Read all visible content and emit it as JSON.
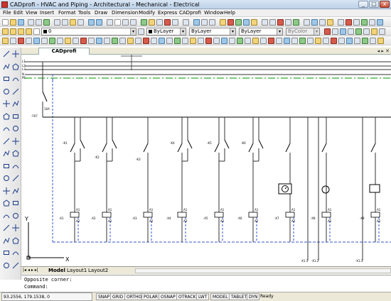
{
  "window": {
    "title": "CADprofi - HVAC and Piping - Architectural - Mechanical - Electrical",
    "minimize": "_",
    "maximize": "□",
    "close": "x"
  },
  "menu": {
    "items": [
      "File",
      "Edit",
      "View",
      "Insert",
      "Format",
      "Tools",
      "Draw",
      "Dimension",
      "Modify",
      "Express",
      "CADprofi",
      "Window",
      "Help"
    ]
  },
  "properties_toolbar": {
    "layer_value": "0",
    "color_value": "ByLayer",
    "linetype_value": "ByLayer",
    "lineweight_value": "ByLayer",
    "plotstyle_value": "ByColor"
  },
  "document": {
    "tab_label": "CADprofi",
    "nav": "◂ ▸ ✕"
  },
  "drawing": {
    "bus_labels": [
      "L1",
      "L2",
      "L3",
      "N",
      "PE"
    ],
    "main_switch_label": "-F07",
    "main_switch_rating": "16A",
    "branch_switch_labels": [
      "-K1",
      "-K2",
      "-K3",
      "-K4",
      "-K5",
      "-K6"
    ],
    "device_labels": [
      "-X1",
      "-X2",
      "-X3",
      "-X4",
      "-X5",
      "-X6",
      "-X7",
      "-X8",
      "-X9"
    ],
    "bottom_terminal_labels": [
      "-X1.1",
      "-X1.2",
      "-X1.3"
    ],
    "terminal_pin_labels": [
      "A1",
      "A2"
    ]
  },
  "ucs": {
    "x_label": "X",
    "y_label": "Y"
  },
  "layout_tabs": {
    "model": "Model",
    "layout1": "Layout1",
    "layout2": "Layout2"
  },
  "command": {
    "line1": "Opposite corner:",
    "line2": "Command:"
  },
  "status": {
    "coords": "93.2556, 179.1538, 0",
    "buttons": [
      "SNAP",
      "GRID",
      "ORTHO",
      "POLAR",
      "OSNAP",
      "OTRACK",
      "LWT",
      "MODEL",
      "TABLET",
      "DYN"
    ],
    "state": "Ready"
  },
  "colors": {
    "bus_gray": "#333333",
    "green_line": "#33aa33",
    "dashed_blue": "#3355cc",
    "toolbar_bg": "#ece9d8"
  },
  "icons": [
    "app-icon",
    "new-icon",
    "open-icon",
    "save-icon",
    "print-icon",
    "cut-icon",
    "copy-icon",
    "paste-icon",
    "undo-icon",
    "redo-icon",
    "pan-icon",
    "zoom-icon",
    "layer-icon",
    "line-icon",
    "polyline-icon",
    "circle-icon",
    "arc-icon",
    "rectangle-icon",
    "hatch-icon",
    "text-icon",
    "move-icon",
    "copy-object-icon",
    "rotate-icon",
    "scale-icon",
    "trim-icon",
    "extend-icon",
    "erase-icon"
  ]
}
